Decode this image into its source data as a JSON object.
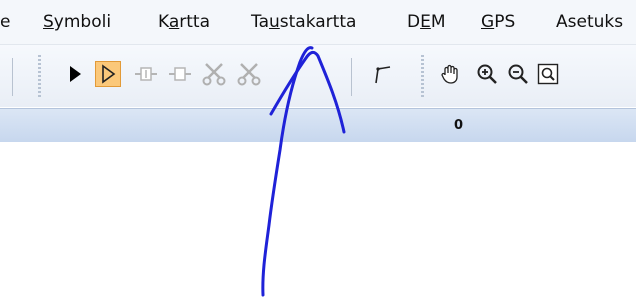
{
  "menu": {
    "items": [
      {
        "id": "edit",
        "label": "e",
        "mnemonic": ""
      },
      {
        "id": "symboli",
        "label": "ymboli",
        "mnemonic": "S"
      },
      {
        "id": "kartta",
        "label": "rtta",
        "mnemonic": "a",
        "pre": "K"
      },
      {
        "id": "taustakartta",
        "label": "stakartta",
        "mnemonic": "u",
        "pre": "Ta"
      },
      {
        "id": "dem",
        "label": "M",
        "mnemonic": "E",
        "pre": "D"
      },
      {
        "id": "gps",
        "label": "PS",
        "mnemonic": "G"
      },
      {
        "id": "asetukset",
        "label": "Asetuks",
        "mnemonic": ""
      }
    ]
  },
  "toolbar": {
    "buttons": [
      {
        "name": "select-arrow-tool",
        "icon": "arrow-filled-icon",
        "selected": false
      },
      {
        "name": "select-outline-tool",
        "icon": "arrow-outline-icon",
        "selected": true
      },
      {
        "name": "add-point-tool",
        "icon": "add-point-icon",
        "selected": false
      },
      {
        "name": "remove-point-tool",
        "icon": "remove-point-icon",
        "selected": false
      },
      {
        "name": "cut-tool",
        "icon": "scissors-icon",
        "selected": false
      },
      {
        "name": "cut-disabled-tool",
        "icon": "scissors-icon",
        "selected": false
      },
      {
        "name": "line-tool",
        "icon": "line-tool-icon",
        "selected": false
      },
      {
        "name": "pan-tool",
        "icon": "hand-icon",
        "selected": false
      },
      {
        "name": "zoom-in-tool",
        "icon": "zoom-in-icon",
        "selected": false
      },
      {
        "name": "zoom-out-tool",
        "icon": "zoom-out-icon",
        "selected": false
      },
      {
        "name": "zoom-fit-tool",
        "icon": "zoom-fit-icon",
        "selected": false
      }
    ]
  },
  "status": {
    "value": "0"
  },
  "colors": {
    "accent": "#fbc87a",
    "annotation": "#1f22d8",
    "statusbar": "#d2dff1"
  }
}
